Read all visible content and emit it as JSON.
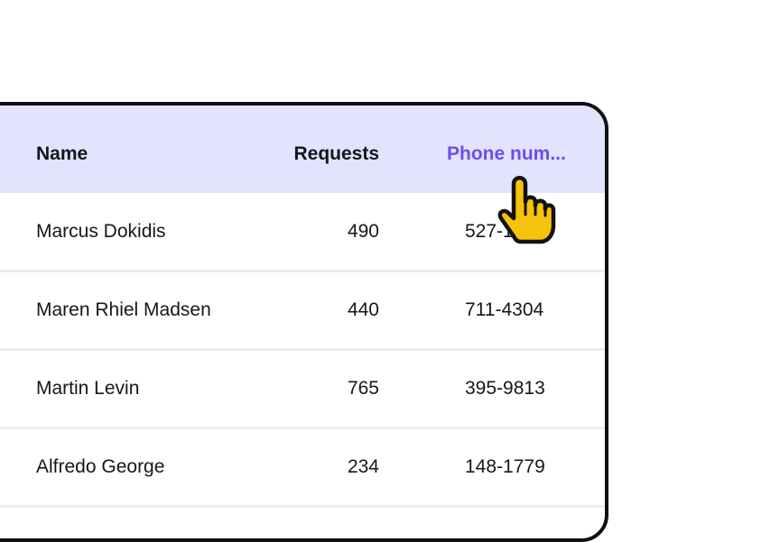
{
  "table": {
    "headers": {
      "name": "Name",
      "requests": "Requests",
      "phone": "Phone num..."
    },
    "rows": [
      {
        "name": "Marcus Dokidis",
        "requests": "490",
        "phone": "527-1960"
      },
      {
        "name": "Maren Rhiel Madsen",
        "requests": "440",
        "phone": "711-4304"
      },
      {
        "name": "Martin Levin",
        "requests": "765",
        "phone": "395-9813"
      },
      {
        "name": "Alfredo George",
        "requests": "234",
        "phone": "148-1779"
      }
    ]
  },
  "cursor": {
    "icon": "pointing-hand-icon",
    "color": "#f7c20b"
  },
  "colors": {
    "header_bg": "#e3e3fd",
    "accent": "#6b4ef0",
    "border": "#0f0f16"
  }
}
